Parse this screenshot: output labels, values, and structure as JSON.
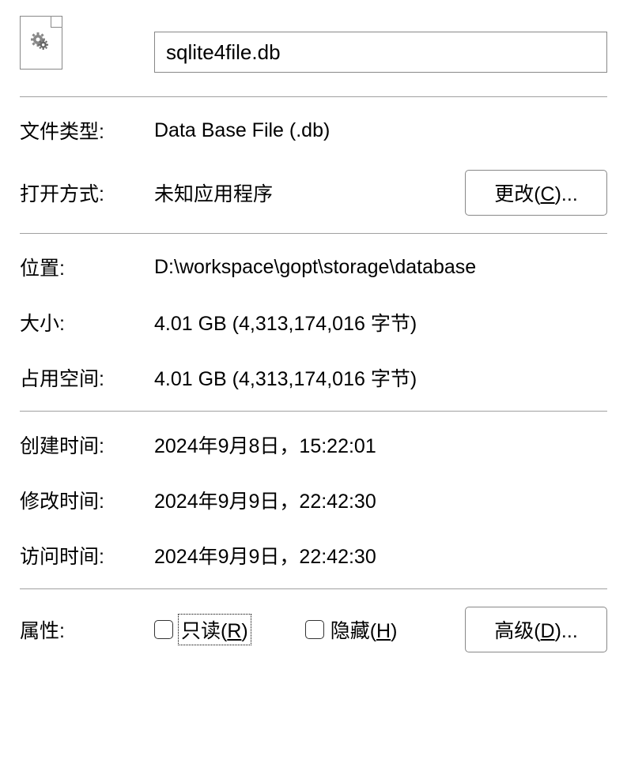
{
  "header": {
    "filename": "sqlite4file.db"
  },
  "fileType": {
    "label": "文件类型:",
    "value": "Data Base File (.db)"
  },
  "openWith": {
    "label": "打开方式:",
    "value": "未知应用程序",
    "button_prefix": "更改(",
    "button_accel": "C",
    "button_suffix": ")..."
  },
  "location": {
    "label": "位置:",
    "value": "D:\\workspace\\gopt\\storage\\database"
  },
  "size": {
    "label": "大小:",
    "value": "4.01 GB (4,313,174,016 字节)"
  },
  "sizeOnDisk": {
    "label": "占用空间:",
    "value": "4.01 GB (4,313,174,016 字节)"
  },
  "created": {
    "label": "创建时间:",
    "value": "2024年9月8日，15:22:01"
  },
  "modified": {
    "label": "修改时间:",
    "value": "2024年9月9日，22:42:30"
  },
  "accessed": {
    "label": "访问时间:",
    "value": "2024年9月9日，22:42:30"
  },
  "attributes": {
    "label": "属性:",
    "readonly_prefix": "只读(",
    "readonly_accel": "R",
    "readonly_suffix": ")",
    "hidden_prefix": "隐藏(",
    "hidden_accel": "H",
    "hidden_suffix": ")",
    "advanced_prefix": "高级(",
    "advanced_accel": "D",
    "advanced_suffix": ")..."
  }
}
